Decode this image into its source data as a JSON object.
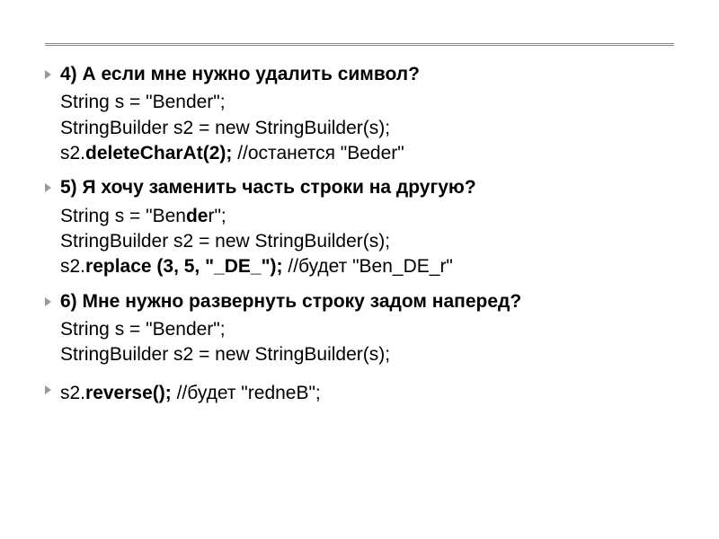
{
  "items": [
    {
      "heading": "4) А если мне нужно удалить символ?",
      "code": [
        [
          {
            "t": "String s = \"Bender\";",
            "b": false
          }
        ],
        [
          {
            "t": "StringBuilder s2 = new StringBuilder(s);",
            "b": false
          }
        ],
        [
          {
            "t": "s2.",
            "b": false
          },
          {
            "t": "deleteCharAt(2);",
            "b": true
          },
          {
            "t": " //останется \"Beder\"",
            "b": false
          }
        ]
      ]
    },
    {
      "heading": "5) Я хочу заменить часть строки на другую?",
      "code": [
        [
          {
            "t": "String s = \"Ben",
            "b": false
          },
          {
            "t": "de",
            "b": true
          },
          {
            "t": "r\";",
            "b": false
          }
        ],
        [
          {
            "t": "StringBuilder s2 = new StringBuilder(s);",
            "b": false
          }
        ],
        [
          {
            "t": "s2.",
            "b": false
          },
          {
            "t": "replace (3, 5, \"_DE_\");",
            "b": true
          },
          {
            "t": " //будет \"Ben_DE_r\"",
            "b": false
          }
        ]
      ]
    },
    {
      "heading": "6) Мне нужно развернуть строку задом наперед?",
      "code": [
        [
          {
            "t": "String s = \"Bender\";",
            "b": false
          }
        ],
        [
          {
            "t": "StringBuilder s2 = new StringBuilder(s);",
            "b": false
          }
        ]
      ]
    }
  ],
  "last_line": [
    {
      "t": "s2.",
      "b": false
    },
    {
      "t": "reverse();",
      "b": true
    },
    {
      "t": " //будет \"redneB\";",
      "b": false
    }
  ]
}
